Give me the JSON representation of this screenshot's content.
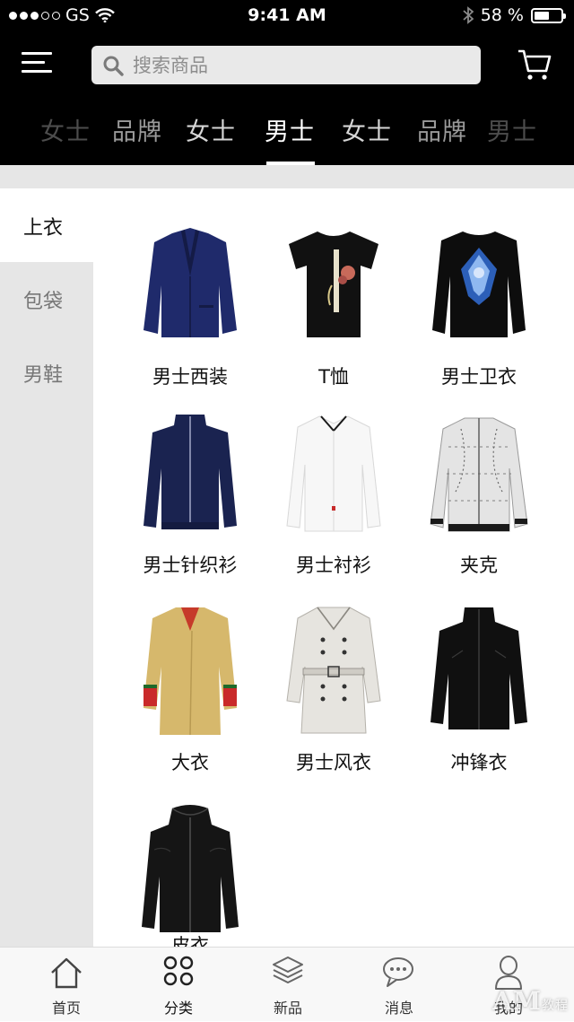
{
  "status_bar": {
    "carrier": "GS",
    "time": "9:41 AM",
    "battery": "58 %",
    "battery_level": 0.58
  },
  "header": {
    "search_placeholder": "搜索商品"
  },
  "category_tabs": [
    {
      "label": "女士"
    },
    {
      "label": "品牌"
    },
    {
      "label": "女士"
    },
    {
      "label": "男士",
      "active": true
    },
    {
      "label": "女士"
    },
    {
      "label": "品牌"
    },
    {
      "label": "男士"
    }
  ],
  "sidebar": {
    "items": [
      {
        "label": "上衣",
        "active": true
      },
      {
        "label": "包袋"
      },
      {
        "label": "男鞋"
      }
    ]
  },
  "products": [
    {
      "name": "男士西装",
      "icon": "suit-jacket-icon"
    },
    {
      "name": "T恤",
      "icon": "tshirt-icon"
    },
    {
      "name": "男士卫衣",
      "icon": "sweatshirt-icon"
    },
    {
      "name": "男士针织衫",
      "icon": "knit-sweater-icon"
    },
    {
      "name": "男士衬衫",
      "icon": "shirt-icon"
    },
    {
      "name": "夹克",
      "icon": "jacket-icon"
    },
    {
      "name": "大衣",
      "icon": "overcoat-icon"
    },
    {
      "name": "男士风衣",
      "icon": "trench-coat-icon"
    },
    {
      "name": "冲锋衣",
      "icon": "shell-jacket-icon"
    },
    {
      "name": "皮衣",
      "icon": "leather-jacket-icon"
    }
  ],
  "tab_bar": {
    "items": [
      {
        "label": "首页",
        "icon": "home-icon"
      },
      {
        "label": "分类",
        "icon": "category-grid-icon"
      },
      {
        "label": "新品",
        "icon": "layers-icon"
      },
      {
        "label": "消息",
        "icon": "chat-icon"
      },
      {
        "label": "我的",
        "icon": "person-icon"
      }
    ]
  },
  "watermark": {
    "main": "AM",
    "sub": "教程"
  },
  "colors": {
    "header_bg": "#000000",
    "sidebar_bg": "#e6e6e6",
    "active_tab": "#ffffff"
  }
}
